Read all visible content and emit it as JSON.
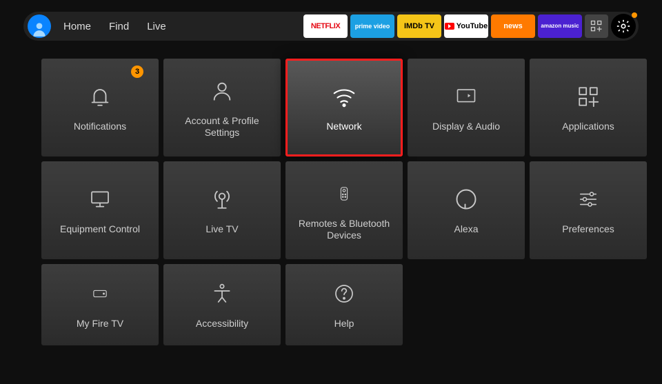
{
  "nav": {
    "home": "Home",
    "find": "Find",
    "live": "Live"
  },
  "apps": {
    "netflix": "NETFLIX",
    "prime_top": "prime video",
    "imdb": "IMDb TV",
    "youtube": "YouTube",
    "news": "news",
    "amusic": "amazon music"
  },
  "tiles": {
    "notifications": "Notifications",
    "notifications_badge": "3",
    "account": "Account & Profile Settings",
    "network": "Network",
    "display": "Display & Audio",
    "applications": "Applications",
    "equip": "Equipment Control",
    "livetv": "Live TV",
    "remotes": "Remotes & Bluetooth Devices",
    "alexa": "Alexa",
    "prefs": "Preferences",
    "myfire": "My Fire TV",
    "access": "Accessibility",
    "help": "Help"
  },
  "selected_tile": "network"
}
